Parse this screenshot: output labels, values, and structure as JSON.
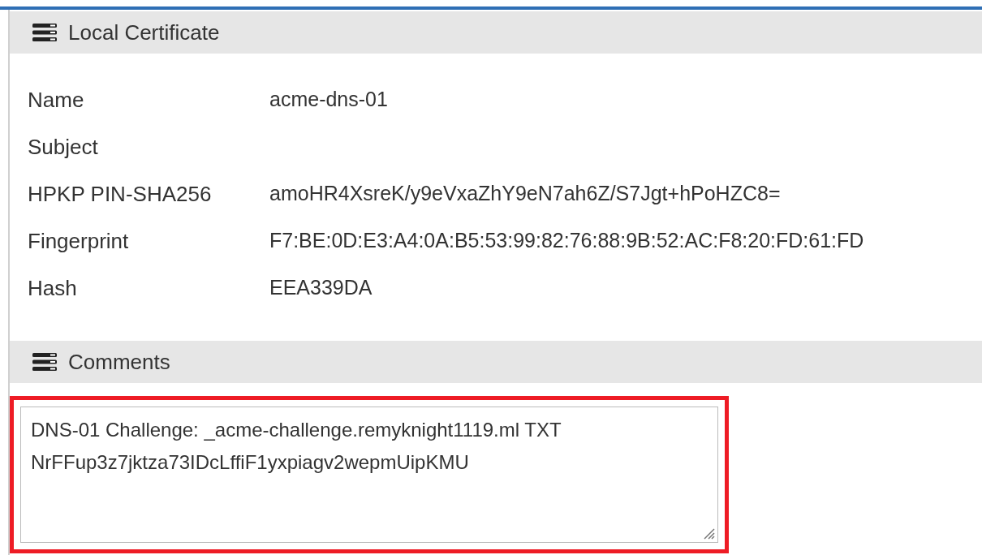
{
  "sections": [
    {
      "title": "Local Certificate",
      "kind": "fields",
      "fields": [
        {
          "label": "Name",
          "value": "acme-dns-01"
        },
        {
          "label": "Subject"
        },
        {
          "label": "HPKP PIN-SHA256",
          "value": "amoHR4XsreK/y9eVxaZhY9eN7ah6Z/S7Jgt+hPoHZC8="
        },
        {
          "label": "Fingerprint",
          "value": "F7:BE:0D:E3:A4:0A:B5:53:99:82:76:88:9B:52:AC:F8:20:FD:61:FD"
        },
        {
          "label": "Hash",
          "value": "EEA339DA"
        }
      ]
    },
    {
      "title": "Comments",
      "kind": "comment",
      "highlighted": true,
      "value": "DNS-01 Challenge: _acme-challenge.remyknight1119.ml TXT\nNrFFup3z7jktza73IDcLffiF1yxpiagv2wepmUipKMU"
    }
  ]
}
